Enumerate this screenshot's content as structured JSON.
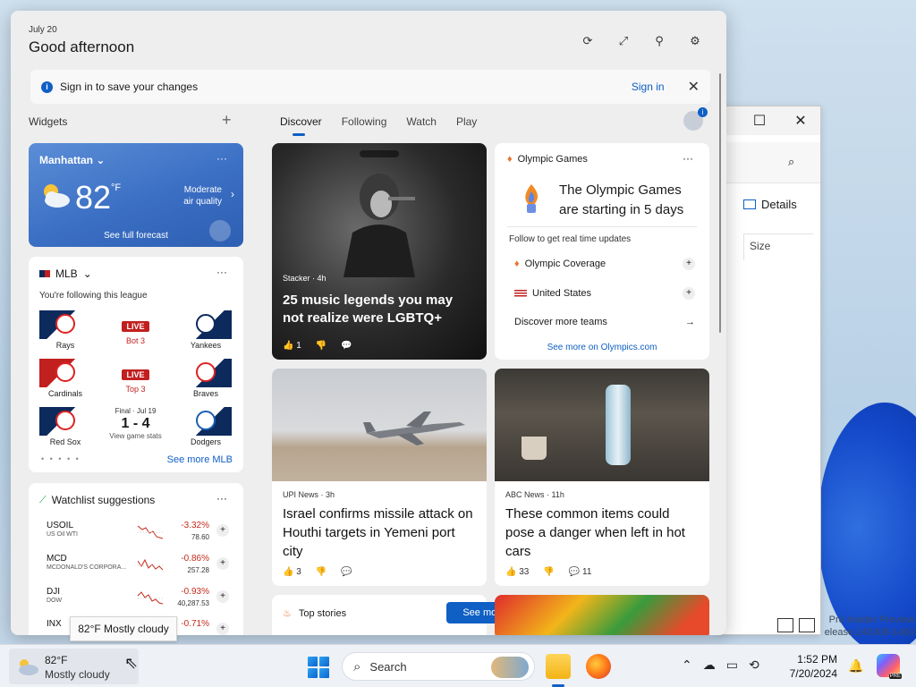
{
  "header": {
    "date": "July 20",
    "greeting": "Good afternoon"
  },
  "banner": {
    "info_glyph": "i",
    "text": "Sign in to save your changes",
    "signin": "Sign in",
    "close": "✕"
  },
  "widgets": {
    "label": "Widgets",
    "add": "+"
  },
  "tabs": [
    "Discover",
    "Following",
    "Watch",
    "Play"
  ],
  "weather": {
    "location": "Manhattan",
    "chevron": "⌄",
    "temp": "82",
    "unit": "°F",
    "air_quality": [
      "Moderate",
      "air quality"
    ],
    "forecast": "See full forecast",
    "more": "···"
  },
  "mlb": {
    "title": "MLB",
    "subtitle": "You're following this league",
    "more": "···",
    "see_more": "See more MLB",
    "pager": "• • • • •",
    "games": [
      {
        "left": "Rays",
        "right": "Yankees",
        "status": "LIVE",
        "detail": "Bot 3"
      },
      {
        "left": "Cardinals",
        "right": "Braves",
        "status": "LIVE",
        "detail": "Top 3"
      },
      {
        "left": "Red Sox",
        "right": "Dodgers",
        "final": "Final · Jul 19",
        "score": "1 - 4",
        "stats": "View game stats"
      }
    ]
  },
  "watchlist": {
    "title": "Watchlist suggestions",
    "more": "···",
    "items": [
      {
        "symbol": "USOIL",
        "name": "US Oil WTI",
        "change": "-3.32%",
        "price": "78.60"
      },
      {
        "symbol": "MCD",
        "name": "MCDONALD'S CORPORA...",
        "change": "-0.86%",
        "price": "257.28"
      },
      {
        "symbol": "DJI",
        "name": "DOW",
        "change": "-0.93%",
        "price": "40,287.53"
      },
      {
        "symbol": "INX",
        "name": "",
        "change": "-0.71%",
        "price": ""
      }
    ]
  },
  "feed": {
    "news1": {
      "source": "Stacker · 4h",
      "title": "25 music legends you may not realize were LGBTQ+",
      "likes": "1"
    },
    "olympics": {
      "header": "Olympic Games",
      "headline": "The Olympic Games are starting in 5 days",
      "follow": "Follow to get real time updates",
      "rows": [
        "Olympic Coverage",
        "United States"
      ],
      "discover": "Discover more teams",
      "see_more": "See more on Olympics.com",
      "more": "···"
    },
    "news2": {
      "source": "UPI News · 3h",
      "title": "Israel confirms missile attack on Houthi targets in Yemeni port city",
      "likes": "3"
    },
    "news3": {
      "source": "ABC News · 11h",
      "title": "These common items could pose a danger when left in hot cars",
      "likes": "33",
      "comments": "11"
    },
    "top_stories": {
      "label": "Top stories",
      "button": "See more"
    }
  },
  "tooltip": "82°F Mostly cloudy",
  "explorer": {
    "details": "Details",
    "size": "Size"
  },
  "insider": [
    "Pro Insider Preview",
    "elease.240308-1400"
  ],
  "taskbar": {
    "weather_temp": "82°F",
    "weather_desc": "Mostly cloudy",
    "search": "Search",
    "time": "1:52 PM",
    "date": "7/20/2024",
    "copilot_badge": "PRE"
  }
}
